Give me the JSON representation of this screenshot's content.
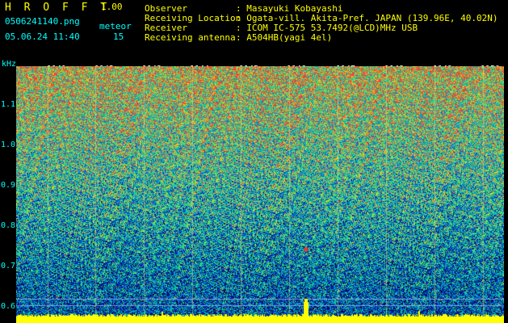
{
  "app": {
    "name": "H R O F F T",
    "version": "1.00",
    "filename": "0506241140.png",
    "datetime": "05.06.24 11:40",
    "meteor_label": "meteor",
    "meteor_count": "15"
  },
  "info": [
    {
      "label": "Observer",
      "value": ": Masayuki Kobayashi"
    },
    {
      "label": "Receiving Location",
      "value": ": Ogata-vill. Akita-Pref. JAPAN (139.96E, 40.02N)"
    },
    {
      "label": "Receiver",
      "value": ": ICOM IC-575 53.7492(@LCD)MHz USB"
    },
    {
      "label": "Receiving antenna",
      "value": ": A504HB(yagi 4el)"
    }
  ],
  "y_axis": {
    "unit": "kHz",
    "ticks": [
      "1.1",
      "1.0",
      "0.9",
      "0.8",
      "0.7",
      "0.6"
    ]
  },
  "x_axis": {
    "ticks": [
      "1141",
      "1142",
      "1143",
      "1144",
      "1145",
      "1146",
      "1147",
      "1148",
      "1149",
      "1150"
    ]
  },
  "colors": {
    "header_text": "#ffff00",
    "info_text": "#00ffff",
    "baseline": "#ffff00"
  }
}
